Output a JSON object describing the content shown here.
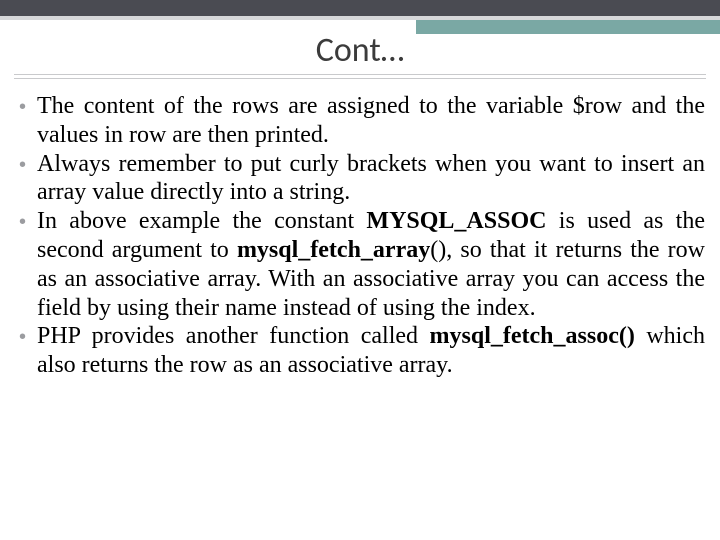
{
  "title": "Cont…",
  "bullets": [
    {
      "segments": [
        {
          "text": "The content of the rows are assigned to the variable $row and the values in row are then printed.",
          "bold": false
        }
      ]
    },
    {
      "segments": [
        {
          "text": "Always remember to put curly brackets when you want to insert an array value directly into a string.",
          "bold": false
        }
      ]
    },
    {
      "segments": [
        {
          "text": "In above example the constant ",
          "bold": false
        },
        {
          "text": "MYSQL_ASSOC",
          "bold": true
        },
        {
          "text": " is used as the second argument to ",
          "bold": false
        },
        {
          "text": "mysql_fetch_array",
          "bold": true
        },
        {
          "text": "(), so that it returns the row as an associative array. With an associative array you can access the field by using their name instead of using the index.",
          "bold": false
        }
      ]
    },
    {
      "segments": [
        {
          "text": "PHP provides another function called ",
          "bold": false
        },
        {
          "text": "mysql_fetch_assoc()",
          "bold": true
        },
        {
          "text": " which also returns the row as an associative array.",
          "bold": false
        }
      ]
    }
  ]
}
